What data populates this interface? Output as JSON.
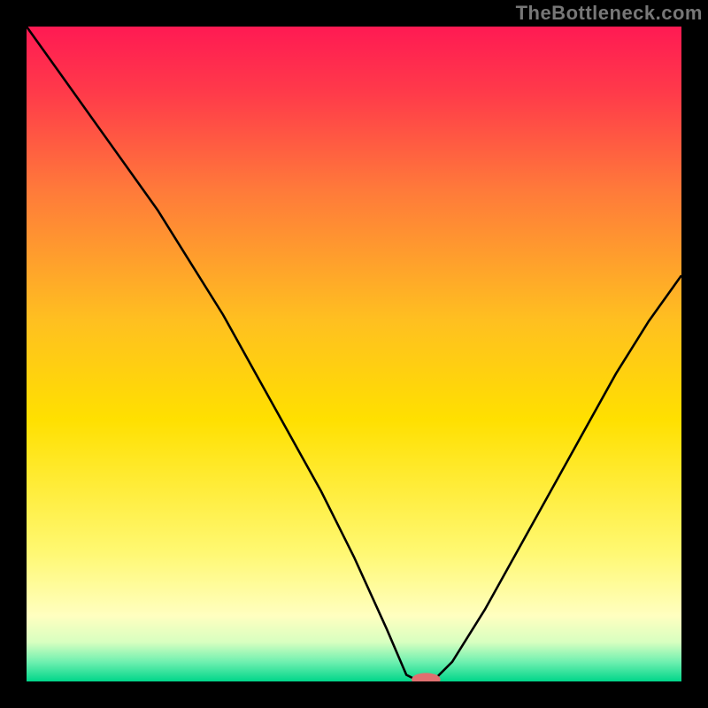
{
  "attribution": "TheBottleneck.com",
  "chart_data": {
    "type": "line",
    "title": "",
    "xlabel": "",
    "ylabel": "",
    "xlim": [
      0,
      100
    ],
    "ylim": [
      0,
      100
    ],
    "background_gradient": {
      "stops": [
        {
          "pos": 0.0,
          "color": "#ff1a53"
        },
        {
          "pos": 0.1,
          "color": "#ff3a4a"
        },
        {
          "pos": 0.25,
          "color": "#ff7a3a"
        },
        {
          "pos": 0.45,
          "color": "#ffc020"
        },
        {
          "pos": 0.6,
          "color": "#ffe000"
        },
        {
          "pos": 0.8,
          "color": "#fff870"
        },
        {
          "pos": 0.9,
          "color": "#ffffc0"
        },
        {
          "pos": 0.94,
          "color": "#d8ffc0"
        },
        {
          "pos": 0.97,
          "color": "#70f0b0"
        },
        {
          "pos": 1.0,
          "color": "#00d68a"
        }
      ]
    },
    "series": [
      {
        "name": "bottleneck-curve",
        "x": [
          0,
          5,
          10,
          15,
          20,
          25,
          30,
          35,
          40,
          45,
          50,
          55,
          58,
          60,
          62,
          65,
          70,
          75,
          80,
          85,
          90,
          95,
          100
        ],
        "y": [
          100,
          93,
          86,
          79,
          72,
          64,
          56,
          47,
          38,
          29,
          19,
          8,
          1,
          0,
          0,
          3,
          11,
          20,
          29,
          38,
          47,
          55,
          62
        ]
      }
    ],
    "marker": {
      "name": "optimal-point",
      "x": 61,
      "y": 0.3,
      "color": "#e07070",
      "rx": 2.2,
      "ry": 1.0
    }
  }
}
